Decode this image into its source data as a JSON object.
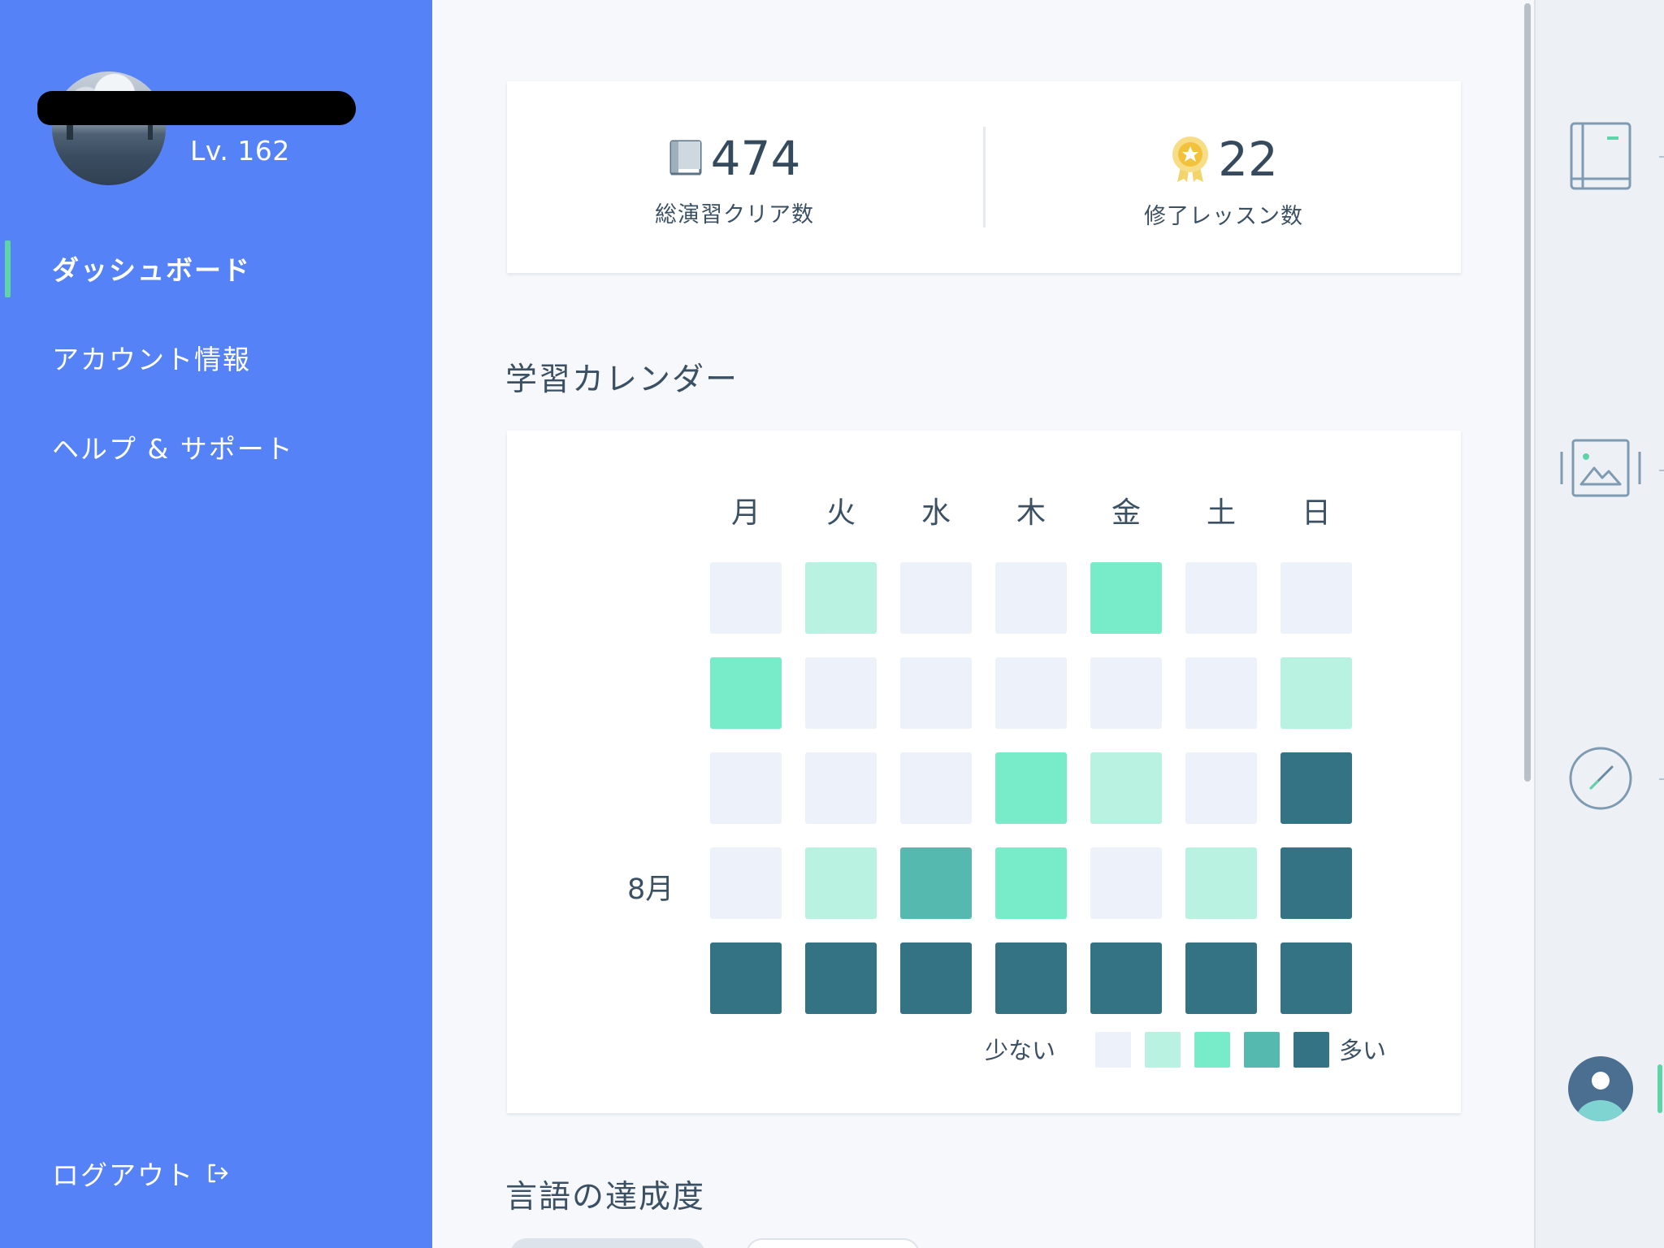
{
  "sidebar": {
    "level": "Lv. 162",
    "nav": [
      {
        "label": "ダッシュボード",
        "active": true
      },
      {
        "label": "アカウント情報",
        "active": false
      },
      {
        "label": "ヘルプ & サポート",
        "active": false
      }
    ],
    "logout": "ログアウト"
  },
  "stats": {
    "exercises": {
      "value": "474",
      "label": "総演習クリア数",
      "icon": "book-icon"
    },
    "lessons": {
      "value": "22",
      "label": "修了レッスン数",
      "icon": "medal-icon"
    }
  },
  "calendar": {
    "title": "学習カレンダー",
    "weekdays": [
      "月",
      "火",
      "水",
      "木",
      "金",
      "土",
      "日"
    ],
    "month_label": "8月",
    "levels": [
      [
        0,
        1,
        0,
        0,
        2,
        0,
        0
      ],
      [
        2,
        0,
        0,
        0,
        0,
        0,
        1
      ],
      [
        0,
        0,
        0,
        2,
        1,
        0,
        4
      ],
      [
        0,
        1,
        3,
        2,
        0,
        1,
        4
      ],
      [
        4,
        4,
        4,
        4,
        4,
        4,
        4
      ]
    ],
    "legend_less": "少ない",
    "legend_more": "多い",
    "colors": [
      "#edf1f9",
      "#baf2e1",
      "#78ecc8",
      "#55b9b0",
      "#337384"
    ]
  },
  "achievement": {
    "title": "言語の達成度"
  },
  "rail": {
    "icons": [
      "book-icon",
      "image-icon",
      "compass-icon",
      "profile-icon"
    ]
  },
  "accent": "#5682f7"
}
